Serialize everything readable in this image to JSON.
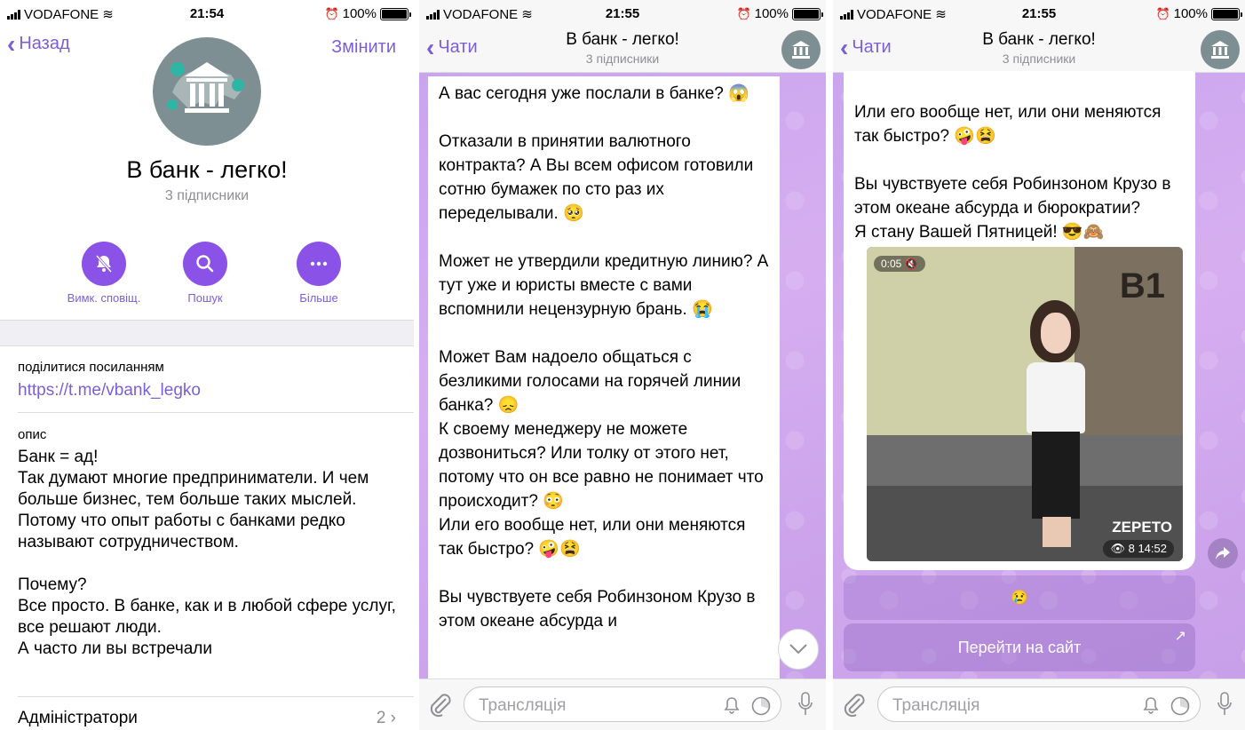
{
  "status_bars": [
    {
      "carrier": "VODAFONE",
      "time": "21:54",
      "battery": "100%"
    },
    {
      "carrier": "VODAFONE",
      "time": "21:55",
      "battery": "100%"
    },
    {
      "carrier": "VODAFONE",
      "time": "21:55",
      "battery": "100%"
    }
  ],
  "profile": {
    "back_label": "Назад",
    "edit_label": "Змінити",
    "channel_name": "В банк - легко!",
    "subscribers": "3 підписники",
    "actions": [
      {
        "label": "Вимк. сповіщ.",
        "icon": "bell-slash-icon"
      },
      {
        "label": "Пошук",
        "icon": "search-icon"
      },
      {
        "label": "Більше",
        "icon": "more-icon"
      }
    ],
    "share_label": "поділитися посиланням",
    "share_link": "https://t.me/vbank_legko",
    "description_label": "опис",
    "description": "Банк = ад!\nТак думают многие предприниматели. И чем больше бизнес, тем больше таких мыслей. Потому что опыт работы с банками редко называют сотрудничеством.\n\nПочему?\nВсе просто. В банке, как и в любой сфере услуг, все решают люди.\nА часто ли вы встречали",
    "admins_label": "Адміністратори",
    "admins_count": "2"
  },
  "chat": {
    "back_label": "Чати",
    "title": "В банк - легко!",
    "subtitle": "3 підписники",
    "input_placeholder": "Трансляція"
  },
  "chat2": {
    "message": "А вас сегодня уже послали в банке? 😱\n\nОтказали в принятии валютного контракта? А Вы всем офисом готовили сотню бумажек по сто раз их переделывали. 🥺\n\nМожет не утвердили кредитную линию? А тут уже и юристы вместе с вами вспомнили нецензурную брань. 😭\n\nМожет Вам надоело общаться с безликими голосами на горячей линии банка? 😞\nК своему менеджеру не можете дозвониться? Или толку от этого нет, потому что он все равно не понимает что происходит? 😳\nИли его вообще нет, или они меняются так быстро? 🤪😫\n\nВы чувствуете себя Робинзоном Крузо в этом океане абсурда и"
  },
  "chat3": {
    "message": "Или его вообще нет, или они меняются так быстро? 🤪😫\n\nВы чувствуете себя Робинзоном Крузо в этом океане абсурда и бюрократии?\nЯ стану Вашей Пятницей! 😎🙈",
    "video_duration": "0:05",
    "video_sign": "B1",
    "video_watermark": "ZEPETO",
    "video_views": "8",
    "video_time": "14:52",
    "reaction": "😢",
    "site_button": "Перейти на сайт"
  }
}
